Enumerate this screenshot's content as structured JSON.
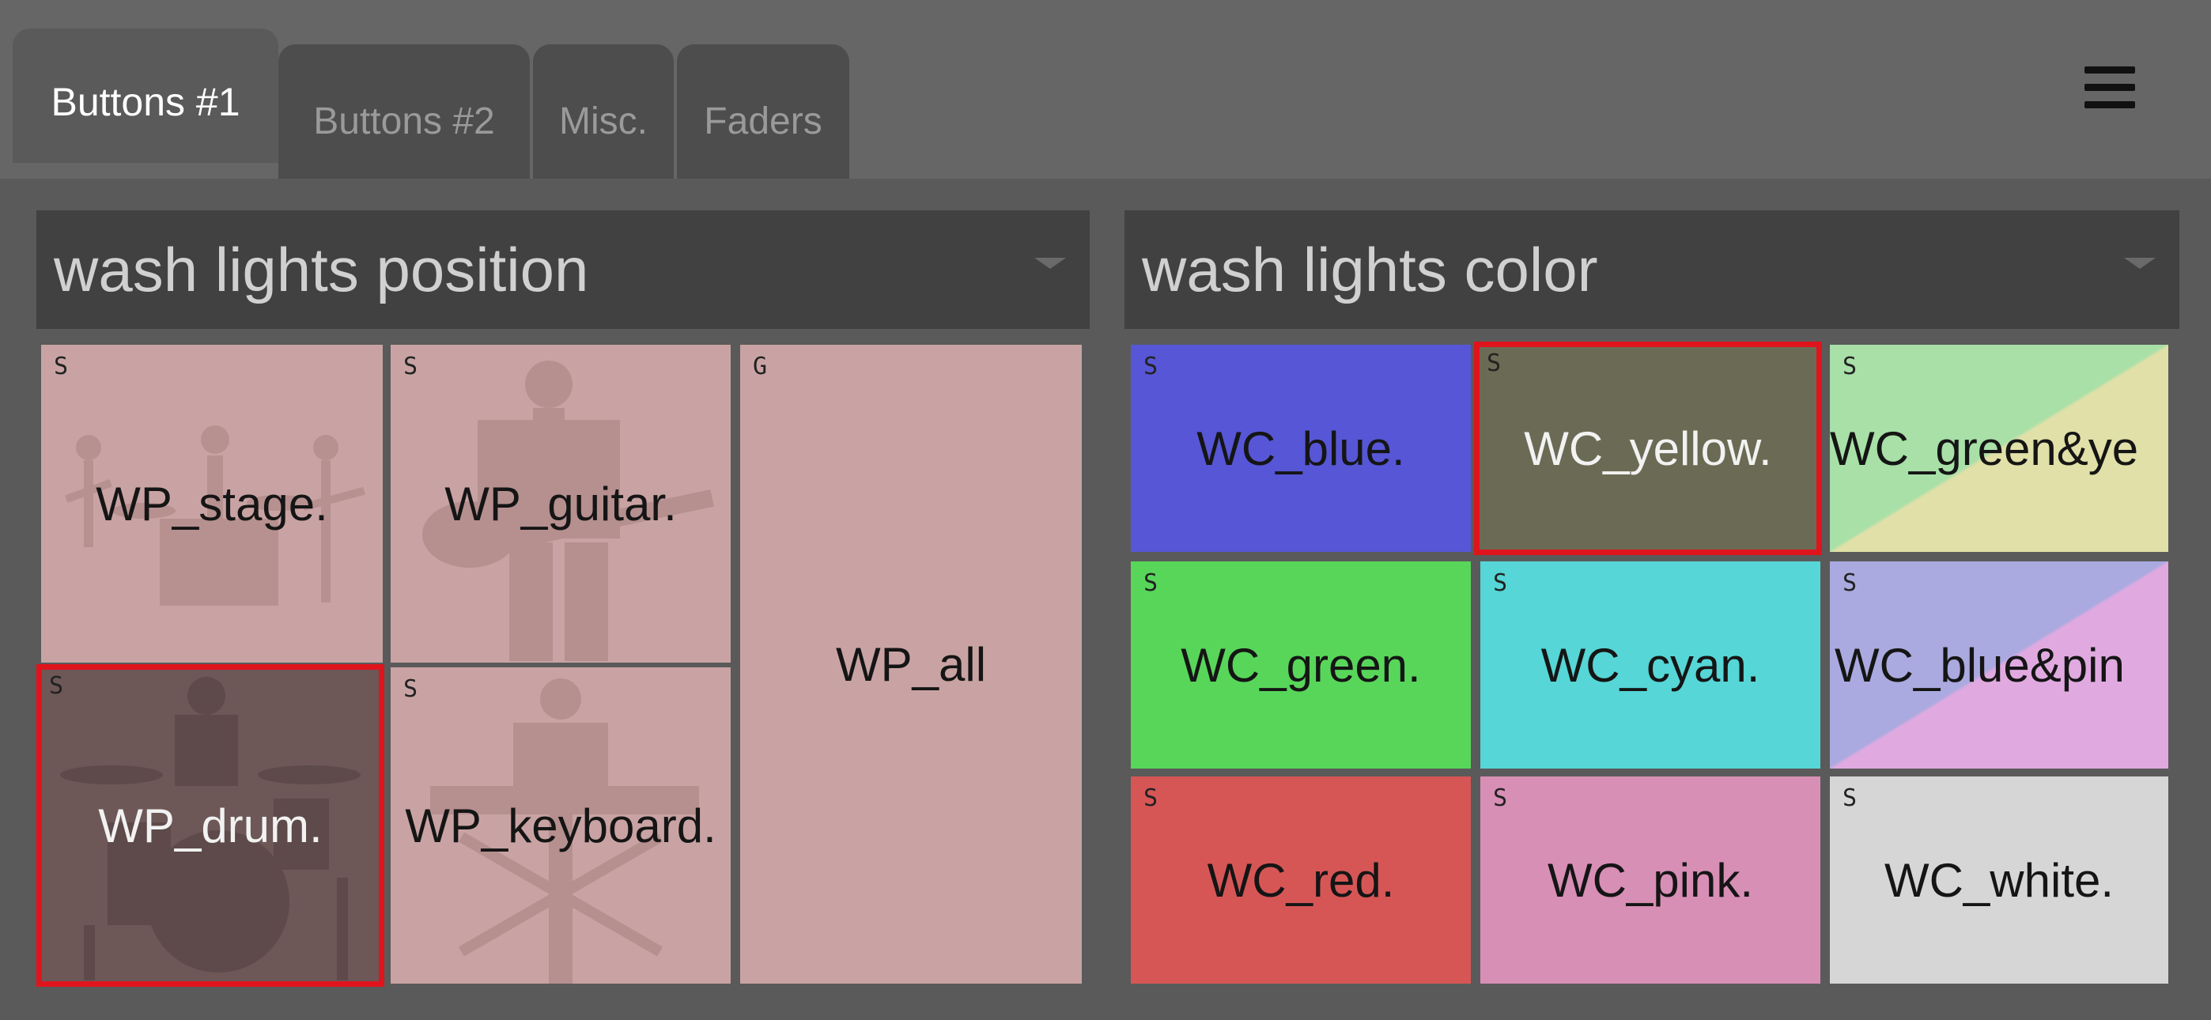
{
  "tabs": [
    {
      "label": "Buttons #1",
      "active": true
    },
    {
      "label": "Buttons #2",
      "active": false
    },
    {
      "label": "Misc.",
      "active": false
    },
    {
      "label": "Faders",
      "active": false
    }
  ],
  "menu_icon": "hamburger-menu-icon",
  "position_panel": {
    "title": "wash lights position",
    "buttons": [
      {
        "label": "WP_stage.",
        "indicator": "S",
        "image": "band-stage-silhouette",
        "color": "#c9a3a3"
      },
      {
        "label": "WP_guitar.",
        "indicator": "S",
        "image": "guitarist-silhouette",
        "color": "#c9a3a3"
      },
      {
        "label": "WP_all",
        "indicator": "G",
        "color": "#c9a3a3"
      },
      {
        "label": "WP_drum.",
        "indicator": "S",
        "image": "drum-kit-silhouette",
        "color": "#6d5757",
        "selected": true
      },
      {
        "label": "WP_keyboard.",
        "indicator": "S",
        "image": "keyboardist-silhouette",
        "color": "#c9a3a3"
      }
    ]
  },
  "color_panel": {
    "title": "wash lights color",
    "buttons": [
      {
        "label": "WC_blue.",
        "indicator": "S",
        "color": "#5656d6"
      },
      {
        "label": "WC_yellow.",
        "indicator": "S",
        "color": "#6b6b55",
        "selected": true
      },
      {
        "label": "WC_green&ye",
        "indicator": "S",
        "color": "#a8e0a8",
        "color2": "#e0e0a8"
      },
      {
        "label": "WC_green.",
        "indicator": "S",
        "color": "#58d65a"
      },
      {
        "label": "WC_cyan.",
        "indicator": "S",
        "color": "#56d6d6"
      },
      {
        "label": "WC_blue&pin",
        "indicator": "S",
        "color": "#aaaae0",
        "color2": "#e0aae0"
      },
      {
        "label": "WC_red.",
        "indicator": "S",
        "color": "#d65656"
      },
      {
        "label": "WC_pink.",
        "indicator": "S",
        "color": "#d88fb5"
      },
      {
        "label": "WC_white.",
        "indicator": "S",
        "color": "#d6d6d6"
      }
    ]
  }
}
